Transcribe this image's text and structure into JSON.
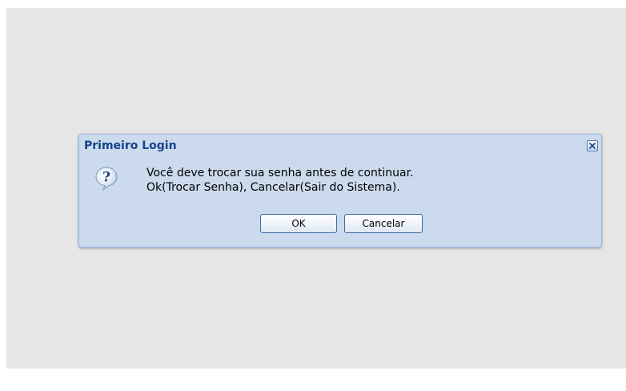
{
  "dialog": {
    "title": "Primeiro Login",
    "message_line1": "Você deve trocar sua senha antes de continuar.",
    "message_line2": "Ok(Trocar Senha), Cancelar(Sair do Sistema).",
    "ok_label": "OK",
    "cancel_label": "Cancelar",
    "icon": "question-icon",
    "close_icon": "close-icon"
  },
  "colors": {
    "page_background": "#e6e6e6",
    "dialog_background": "#cbdaec",
    "dialog_border": "#99bbe8",
    "title_text": "#15428b"
  }
}
